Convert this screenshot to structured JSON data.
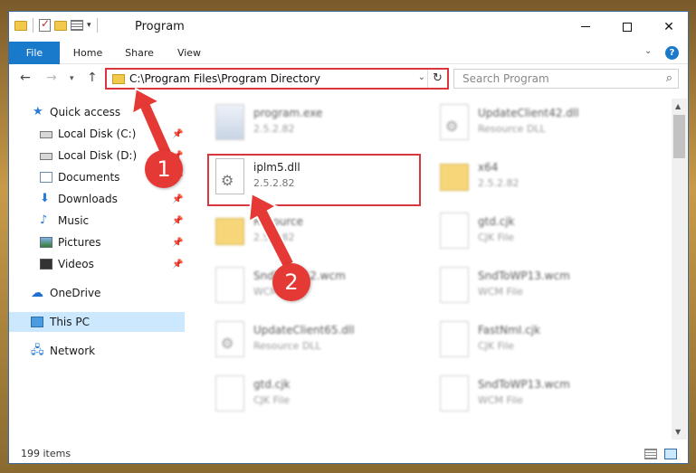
{
  "window": {
    "title": "Program",
    "controls": {
      "minimize": "",
      "maximize": "",
      "close": "✕"
    }
  },
  "ribbon": {
    "tabs": [
      "File",
      "Home",
      "Share",
      "View"
    ],
    "help": "?"
  },
  "navigation": {
    "address": "C:\\Program Files\\Program Directory",
    "search_placeholder": "Search Program"
  },
  "sidebar": {
    "items": [
      {
        "label": "Quick access",
        "icon": "star-icon",
        "pinned": false
      },
      {
        "label": "Local Disk (C:)",
        "icon": "drive-icon",
        "pinned": true
      },
      {
        "label": "Local Disk (D:)",
        "icon": "drive-icon",
        "pinned": true
      },
      {
        "label": "Documents",
        "icon": "documents-icon",
        "pinned": true
      },
      {
        "label": "Downloads",
        "icon": "download-icon",
        "pinned": true
      },
      {
        "label": "Music",
        "icon": "music-icon",
        "pinned": true
      },
      {
        "label": "Pictures",
        "icon": "pictures-icon",
        "pinned": true
      },
      {
        "label": "Videos",
        "icon": "videos-icon",
        "pinned": true
      },
      {
        "label": "OneDrive",
        "icon": "cloud-icon",
        "pinned": false
      },
      {
        "label": "This PC",
        "icon": "computer-icon",
        "pinned": false,
        "selected": true
      },
      {
        "label": "Network",
        "icon": "network-icon",
        "pinned": false
      }
    ]
  },
  "files": [
    {
      "name": "program.exe",
      "sub": "2.5.2.82"
    },
    {
      "name": "UpdateClient42.dll",
      "sub": "Resource DLL"
    },
    {
      "name": "iplm5.dll",
      "sub": "2.5.2.82"
    },
    {
      "name": "x64",
      "sub": "2.5.2.82"
    },
    {
      "name": "Resource",
      "sub": "2.5.2.82"
    },
    {
      "name": "gtd.cjk",
      "sub": "CJK File"
    },
    {
      "name": "SndToWP12.wcm",
      "sub": "WCM File"
    },
    {
      "name": "SndToWP13.wcm",
      "sub": "WCM File"
    },
    {
      "name": "UpdateClient65.dll",
      "sub": "Resource DLL"
    },
    {
      "name": "FastNmI.cjk",
      "sub": "CJK File"
    },
    {
      "name": "gtd.cjk",
      "sub": "CJK File"
    },
    {
      "name": "SndToWP13.wcm",
      "sub": "WCM File"
    }
  ],
  "status": {
    "item_count": "199 items"
  },
  "annotations": {
    "step1": "1",
    "step2": "2",
    "color": "#e53935"
  },
  "colors": {
    "accent": "#1979ca",
    "highlight": "#d9363e",
    "selected_bg": "#cce8ff"
  }
}
